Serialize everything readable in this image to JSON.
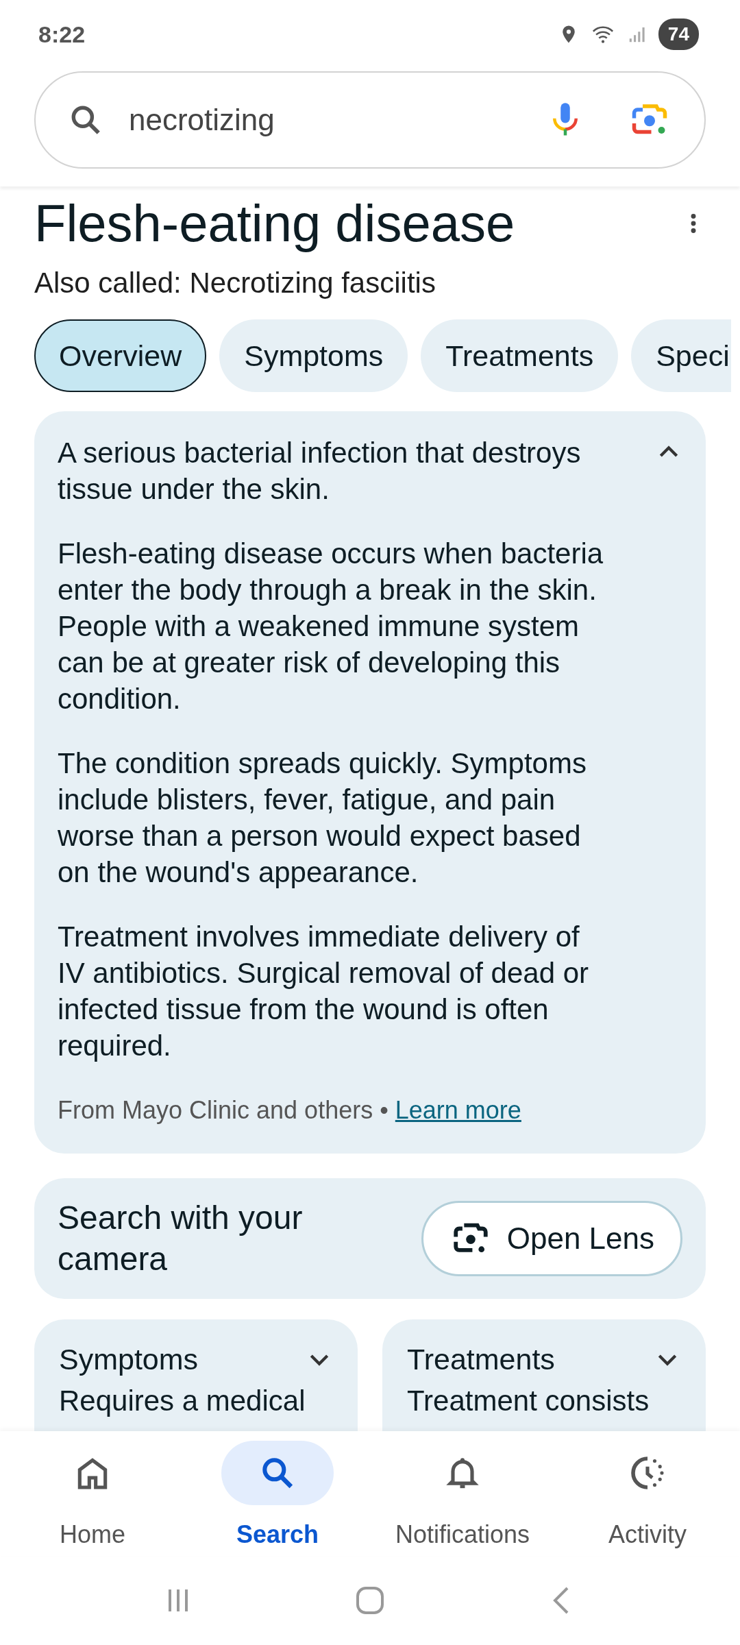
{
  "status_bar": {
    "time": "8:22",
    "battery": "74"
  },
  "search": {
    "value": "necrotizing"
  },
  "title": "Flesh-eating disease",
  "also_called": "Also called: Necrotizing fasciitis",
  "tabs": [
    {
      "label": "Overview",
      "selected": true
    },
    {
      "label": "Symptoms",
      "selected": false
    },
    {
      "label": "Treatments",
      "selected": false
    },
    {
      "label": "Speci",
      "selected": false
    }
  ],
  "overview": {
    "expanded": true,
    "summary": "A serious bacterial infection that destroys tissue under the skin.",
    "paragraphs": [
      "Flesh-eating disease occurs when bacteria enter the body through a break in the skin. People with a weakened immune system can be at greater risk of developing this condition.",
      "The condition spreads quickly. Symptoms include blisters, fever, fatigue, and pain worse than a person would expect based on the wound's appearance.",
      "Treatment involves immediate delivery of IV antibiotics. Surgical removal of dead or infected tissue from the wound is often required."
    ],
    "source": "From Mayo Clinic and others •",
    "link": "Learn more"
  },
  "lens": {
    "text": "Search with your camera",
    "button": "Open Lens"
  },
  "sections": [
    {
      "title": "Symptoms",
      "expanded": false,
      "preview": "Requires a medical"
    },
    {
      "title": "Treatments",
      "expanded": false,
      "preview": "Treatment consists"
    }
  ],
  "nav": [
    {
      "label": "Home",
      "selected": false
    },
    {
      "label": "Search",
      "selected": true
    },
    {
      "label": "Notifications",
      "selected": false
    },
    {
      "label": "Activity",
      "selected": false
    }
  ]
}
